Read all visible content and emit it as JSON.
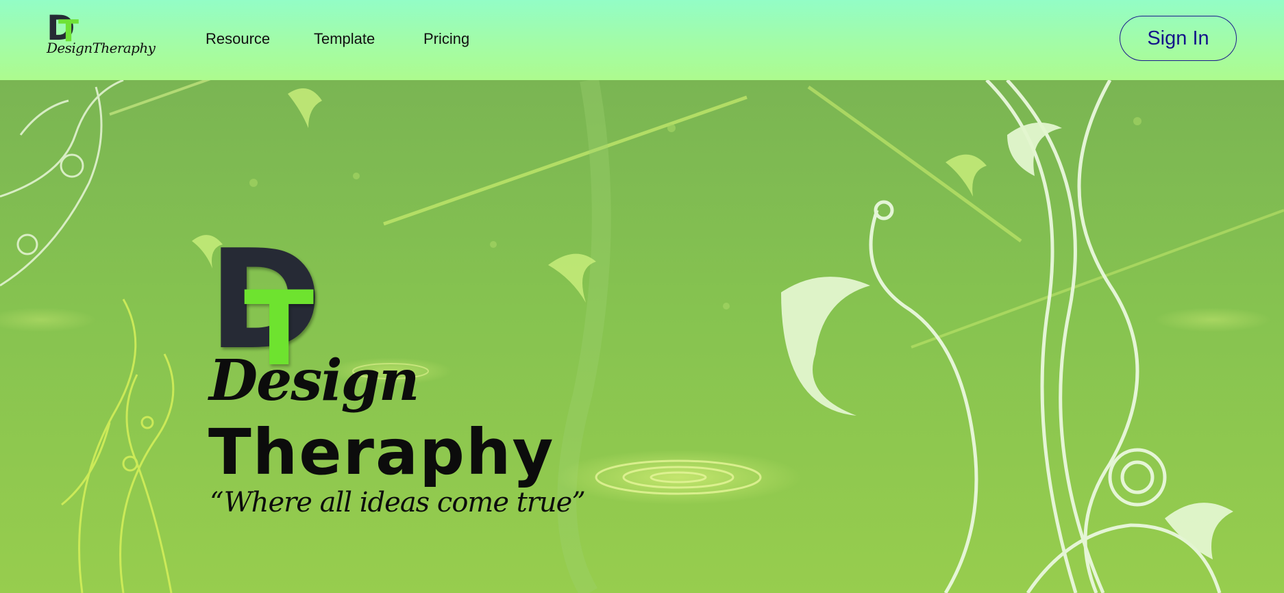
{
  "header": {
    "logo": {
      "mark_d": "D",
      "mark_t": "T",
      "text": "DesignTheraphy"
    },
    "nav": [
      {
        "label": "Resource"
      },
      {
        "label": "Template"
      },
      {
        "label": "Pricing"
      }
    ],
    "signin_label": "Sign In"
  },
  "hero": {
    "mark_d": "D",
    "mark_t": "T",
    "line1": "Design",
    "line2": "Theraphy",
    "tagline": "“Where all ideas come true”"
  },
  "colors": {
    "header_top": "#93fdc6",
    "header_bottom": "#adfb8e",
    "hero_background": "#86c350",
    "brand_green": "#6ee32f",
    "brand_dark": "#262a35",
    "signin_color": "#14148a"
  },
  "icons": [
    "dt-logo-mark",
    "floral-swirl-decoration"
  ]
}
